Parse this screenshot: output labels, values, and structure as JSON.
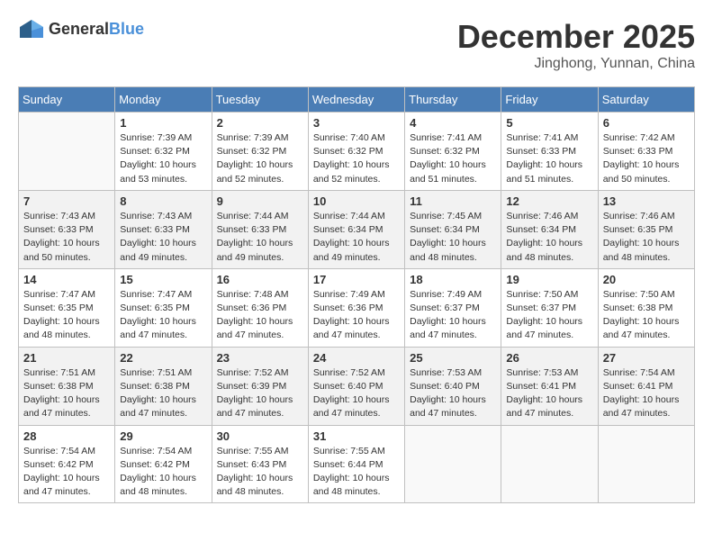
{
  "logo": {
    "general": "General",
    "blue": "Blue"
  },
  "title": "December 2025",
  "location": "Jinghong, Yunnan, China",
  "headers": [
    "Sunday",
    "Monday",
    "Tuesday",
    "Wednesday",
    "Thursday",
    "Friday",
    "Saturday"
  ],
  "weeks": [
    [
      {
        "day": "",
        "info": ""
      },
      {
        "day": "1",
        "info": "Sunrise: 7:39 AM\nSunset: 6:32 PM\nDaylight: 10 hours\nand 53 minutes."
      },
      {
        "day": "2",
        "info": "Sunrise: 7:39 AM\nSunset: 6:32 PM\nDaylight: 10 hours\nand 52 minutes."
      },
      {
        "day": "3",
        "info": "Sunrise: 7:40 AM\nSunset: 6:32 PM\nDaylight: 10 hours\nand 52 minutes."
      },
      {
        "day": "4",
        "info": "Sunrise: 7:41 AM\nSunset: 6:32 PM\nDaylight: 10 hours\nand 51 minutes."
      },
      {
        "day": "5",
        "info": "Sunrise: 7:41 AM\nSunset: 6:33 PM\nDaylight: 10 hours\nand 51 minutes."
      },
      {
        "day": "6",
        "info": "Sunrise: 7:42 AM\nSunset: 6:33 PM\nDaylight: 10 hours\nand 50 minutes."
      }
    ],
    [
      {
        "day": "7",
        "info": "Sunrise: 7:43 AM\nSunset: 6:33 PM\nDaylight: 10 hours\nand 50 minutes."
      },
      {
        "day": "8",
        "info": "Sunrise: 7:43 AM\nSunset: 6:33 PM\nDaylight: 10 hours\nand 49 minutes."
      },
      {
        "day": "9",
        "info": "Sunrise: 7:44 AM\nSunset: 6:33 PM\nDaylight: 10 hours\nand 49 minutes."
      },
      {
        "day": "10",
        "info": "Sunrise: 7:44 AM\nSunset: 6:34 PM\nDaylight: 10 hours\nand 49 minutes."
      },
      {
        "day": "11",
        "info": "Sunrise: 7:45 AM\nSunset: 6:34 PM\nDaylight: 10 hours\nand 48 minutes."
      },
      {
        "day": "12",
        "info": "Sunrise: 7:46 AM\nSunset: 6:34 PM\nDaylight: 10 hours\nand 48 minutes."
      },
      {
        "day": "13",
        "info": "Sunrise: 7:46 AM\nSunset: 6:35 PM\nDaylight: 10 hours\nand 48 minutes."
      }
    ],
    [
      {
        "day": "14",
        "info": "Sunrise: 7:47 AM\nSunset: 6:35 PM\nDaylight: 10 hours\nand 48 minutes."
      },
      {
        "day": "15",
        "info": "Sunrise: 7:47 AM\nSunset: 6:35 PM\nDaylight: 10 hours\nand 47 minutes."
      },
      {
        "day": "16",
        "info": "Sunrise: 7:48 AM\nSunset: 6:36 PM\nDaylight: 10 hours\nand 47 minutes."
      },
      {
        "day": "17",
        "info": "Sunrise: 7:49 AM\nSunset: 6:36 PM\nDaylight: 10 hours\nand 47 minutes."
      },
      {
        "day": "18",
        "info": "Sunrise: 7:49 AM\nSunset: 6:37 PM\nDaylight: 10 hours\nand 47 minutes."
      },
      {
        "day": "19",
        "info": "Sunrise: 7:50 AM\nSunset: 6:37 PM\nDaylight: 10 hours\nand 47 minutes."
      },
      {
        "day": "20",
        "info": "Sunrise: 7:50 AM\nSunset: 6:38 PM\nDaylight: 10 hours\nand 47 minutes."
      }
    ],
    [
      {
        "day": "21",
        "info": "Sunrise: 7:51 AM\nSunset: 6:38 PM\nDaylight: 10 hours\nand 47 minutes."
      },
      {
        "day": "22",
        "info": "Sunrise: 7:51 AM\nSunset: 6:38 PM\nDaylight: 10 hours\nand 47 minutes."
      },
      {
        "day": "23",
        "info": "Sunrise: 7:52 AM\nSunset: 6:39 PM\nDaylight: 10 hours\nand 47 minutes."
      },
      {
        "day": "24",
        "info": "Sunrise: 7:52 AM\nSunset: 6:40 PM\nDaylight: 10 hours\nand 47 minutes."
      },
      {
        "day": "25",
        "info": "Sunrise: 7:53 AM\nSunset: 6:40 PM\nDaylight: 10 hours\nand 47 minutes."
      },
      {
        "day": "26",
        "info": "Sunrise: 7:53 AM\nSunset: 6:41 PM\nDaylight: 10 hours\nand 47 minutes."
      },
      {
        "day": "27",
        "info": "Sunrise: 7:54 AM\nSunset: 6:41 PM\nDaylight: 10 hours\nand 47 minutes."
      }
    ],
    [
      {
        "day": "28",
        "info": "Sunrise: 7:54 AM\nSunset: 6:42 PM\nDaylight: 10 hours\nand 47 minutes."
      },
      {
        "day": "29",
        "info": "Sunrise: 7:54 AM\nSunset: 6:42 PM\nDaylight: 10 hours\nand 48 minutes."
      },
      {
        "day": "30",
        "info": "Sunrise: 7:55 AM\nSunset: 6:43 PM\nDaylight: 10 hours\nand 48 minutes."
      },
      {
        "day": "31",
        "info": "Sunrise: 7:55 AM\nSunset: 6:44 PM\nDaylight: 10 hours\nand 48 minutes."
      },
      {
        "day": "",
        "info": ""
      },
      {
        "day": "",
        "info": ""
      },
      {
        "day": "",
        "info": ""
      }
    ]
  ]
}
